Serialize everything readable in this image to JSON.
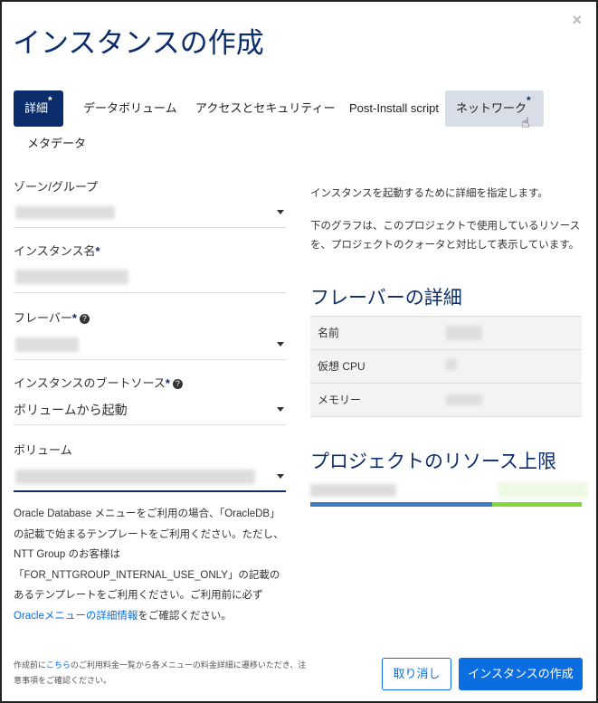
{
  "dialog": {
    "title": "インスタンスの作成",
    "close": "×"
  },
  "tabs": [
    {
      "label": "詳細",
      "required": "*"
    },
    {
      "label": "データボリューム"
    },
    {
      "label": "アクセスとセキュリティー"
    },
    {
      "label": "Post-Install script"
    },
    {
      "label": "ネットワーク",
      "required": "*"
    },
    {
      "label": "メタデータ"
    }
  ],
  "form": {
    "zone_label": "ゾーン/グループ",
    "name_label": "インスタンス名",
    "name_star": "*",
    "flavor_label": "フレーバー",
    "flavor_star": "*",
    "boot_label": "インスタンスのブートソース",
    "boot_star": "*",
    "boot_value": "ボリュームから起動",
    "volume_label": "ボリューム",
    "help_icon": "?"
  },
  "note": {
    "line1": "Oracle Database メニューをご利用の場合、「OracleDB」の記載で始まるテンプレートをご利用ください。ただし、NTT Group のお客様は「FOR_NTTGROUP_INTERNAL_USE_ONLY」の記載のあるテンプレートをご利用ください。ご利用前に必ず",
    "link": "Oracleメニューの詳細情報",
    "line2": "をご確認ください。"
  },
  "right": {
    "intro": "インスタンスを起動するために詳細を指定します。",
    "graph_desc": "下のグラフは、このプロジェクトで使用しているリソースを、プロジェクトのクォータと対比して表示しています。",
    "flavor_heading": "フレーバーの詳細",
    "flavor_rows": [
      "名前",
      "仮想 CPU",
      "メモリー"
    ],
    "limit_heading": "プロジェクトのリソース上限",
    "usage_percent": 67
  },
  "footer": {
    "note_pre": "作成前に",
    "note_link": "こちら",
    "note_post": "のご利用料金一覧から各メニューの料金詳細に遷移いただき、注意事項をご確認ください。",
    "cancel": "取り消し",
    "create": "インスタンスの作成"
  }
}
